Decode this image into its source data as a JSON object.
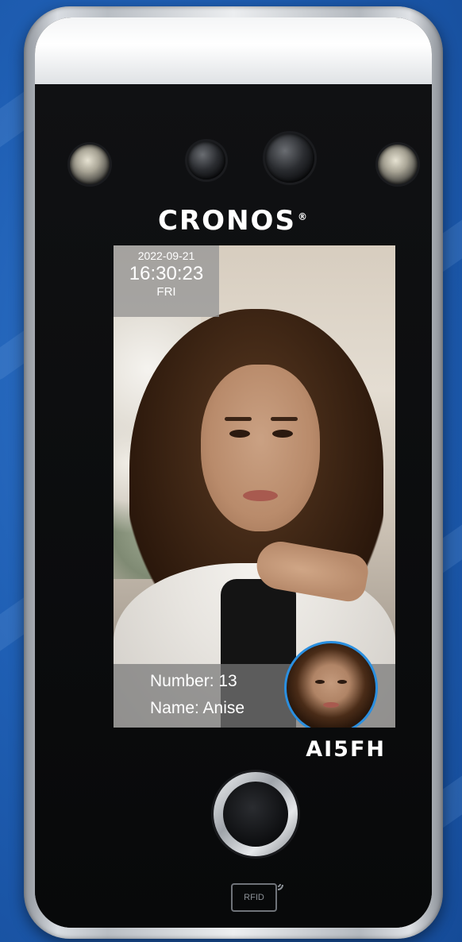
{
  "device": {
    "brand": "CRONOS",
    "trademark": "®",
    "model": "AI5FH",
    "rfid_label": "RFID"
  },
  "screen": {
    "date": "2022-09-21",
    "time": "16:30:23",
    "day": "FRI",
    "number_line": "Number: 13",
    "name_line": "Name: Anise"
  },
  "colors": {
    "background": "#1f5fb4",
    "avatar_ring": "#2a8fe0",
    "device_face": "#0b0c0e"
  },
  "icons": {
    "fingerprint": "fingerprint-sensor-icon",
    "rfid": "rfid-wave-icon"
  }
}
